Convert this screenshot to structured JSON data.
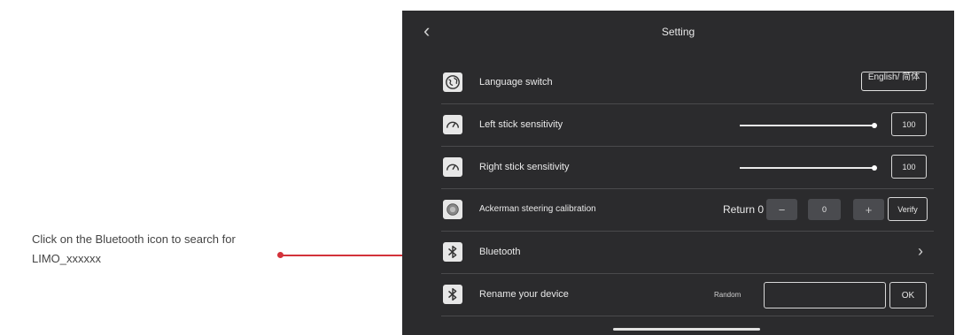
{
  "annotation": {
    "text": "Click on the Bluetooth icon to search for LIMO_xxxxxx",
    "accent_color": "#d3323a"
  },
  "header": {
    "back_icon": "chevron-left-icon",
    "title": "Setting"
  },
  "settings": {
    "language": {
      "label": "Language switch",
      "icon": "globe-icon",
      "value": "English/ 简体"
    },
    "left_stick": {
      "label": "Left stick sensitivity",
      "icon": "gauge-icon",
      "value": "100",
      "level": 1.0
    },
    "right_stick": {
      "label": "Right stick sensitivity",
      "icon": "gauge-icon",
      "value": "100",
      "level": 1.0
    },
    "ackerman": {
      "label": "Ackerman steering calibration",
      "icon": "steering-icon",
      "return_label": "Return 0",
      "minus_label": "−",
      "value": "0",
      "plus_label": "+",
      "verify_label": "Verify"
    },
    "bluetooth": {
      "label": "Bluetooth",
      "icon": "bluetooth-icon",
      "chevron": "chevron-right-icon"
    },
    "rename": {
      "label": "Rename your device",
      "icon": "bluetooth-icon",
      "random_label": "Random",
      "input_value": "",
      "ok_label": "OK"
    }
  },
  "colors": {
    "panel_bg": "#2b2b2d",
    "button_bg": "#4a4b4f"
  }
}
